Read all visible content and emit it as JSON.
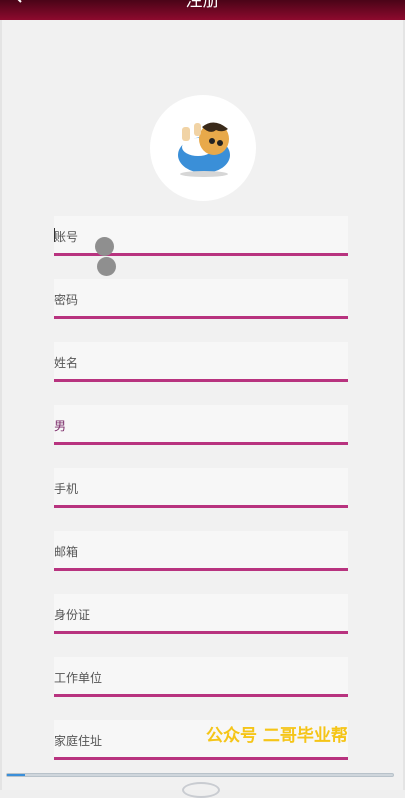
{
  "header": {
    "title": "注册"
  },
  "form": {
    "fields": [
      {
        "label": "账号"
      },
      {
        "label": "密码"
      },
      {
        "label": "姓名"
      },
      {
        "label": "男"
      },
      {
        "label": "手机"
      },
      {
        "label": "邮箱"
      },
      {
        "label": "身份证"
      },
      {
        "label": "工作单位"
      },
      {
        "label": "家庭住址"
      }
    ]
  },
  "watermark": {
    "text": "公众号 二哥毕业帮"
  },
  "colors": {
    "accent": "#b8337f",
    "header": "#8e0a2e",
    "watermark": "#f5c518"
  },
  "icons": {
    "back": "chevron-left-icon",
    "avatar": "cartoon-avatar"
  },
  "scroll": {
    "position": 0.0
  }
}
